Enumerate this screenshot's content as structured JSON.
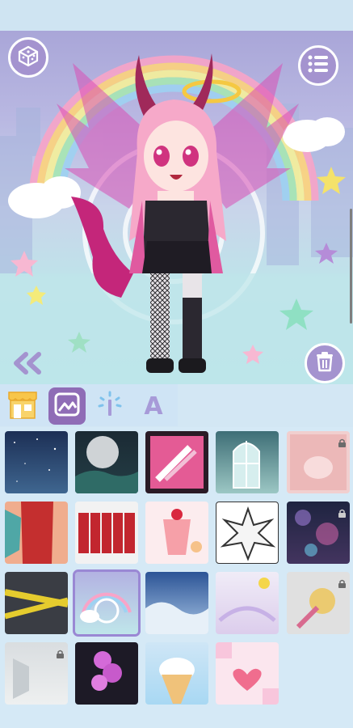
{
  "toolbar": {
    "random_icon": "dice-icon",
    "menu_icon": "list-icon",
    "back_icon": "double-chevron-left-icon",
    "delete_icon": "trash-icon"
  },
  "tabs": [
    {
      "name": "shop",
      "icon": "shop-icon",
      "selected": false
    },
    {
      "name": "backgrounds",
      "icon": "picture-icon",
      "selected": true
    },
    {
      "name": "effects",
      "icon": "magic-wand-icon",
      "selected": false
    },
    {
      "name": "text",
      "label": "A",
      "selected": false
    }
  ],
  "backgrounds": [
    {
      "name": "starry-night",
      "locked": false,
      "selected": false
    },
    {
      "name": "full-moon",
      "locked": false,
      "selected": false
    },
    {
      "name": "syringes",
      "locked": false,
      "selected": false
    },
    {
      "name": "arched-window",
      "locked": false,
      "selected": false
    },
    {
      "name": "pink-cake",
      "locked": true,
      "selected": false
    },
    {
      "name": "red-scales",
      "locked": false,
      "selected": false
    },
    {
      "name": "blood-bags",
      "locked": false,
      "selected": false
    },
    {
      "name": "dessert-drink",
      "locked": false,
      "selected": false
    },
    {
      "name": "comic-burst",
      "locked": false,
      "selected": false
    },
    {
      "name": "bokeh-lights",
      "locked": true,
      "selected": false
    },
    {
      "name": "caution-tape",
      "locked": false,
      "selected": false
    },
    {
      "name": "rainbow-clouds",
      "locked": false,
      "selected": true
    },
    {
      "name": "blue-waves",
      "locked": false,
      "selected": false
    },
    {
      "name": "sun-rainbow",
      "locked": false,
      "selected": false
    },
    {
      "name": "gem-wand",
      "locked": true,
      "selected": false
    },
    {
      "name": "empty-room",
      "locked": true,
      "selected": false
    },
    {
      "name": "purple-balloons",
      "locked": false,
      "selected": false
    },
    {
      "name": "ice-cream",
      "locked": false,
      "selected": false
    },
    {
      "name": "pink-hearts",
      "locked": false,
      "selected": false
    }
  ],
  "colors": {
    "accent": "#8f6cb6",
    "button": "#a493cf",
    "panel": "#d5e9f6"
  }
}
